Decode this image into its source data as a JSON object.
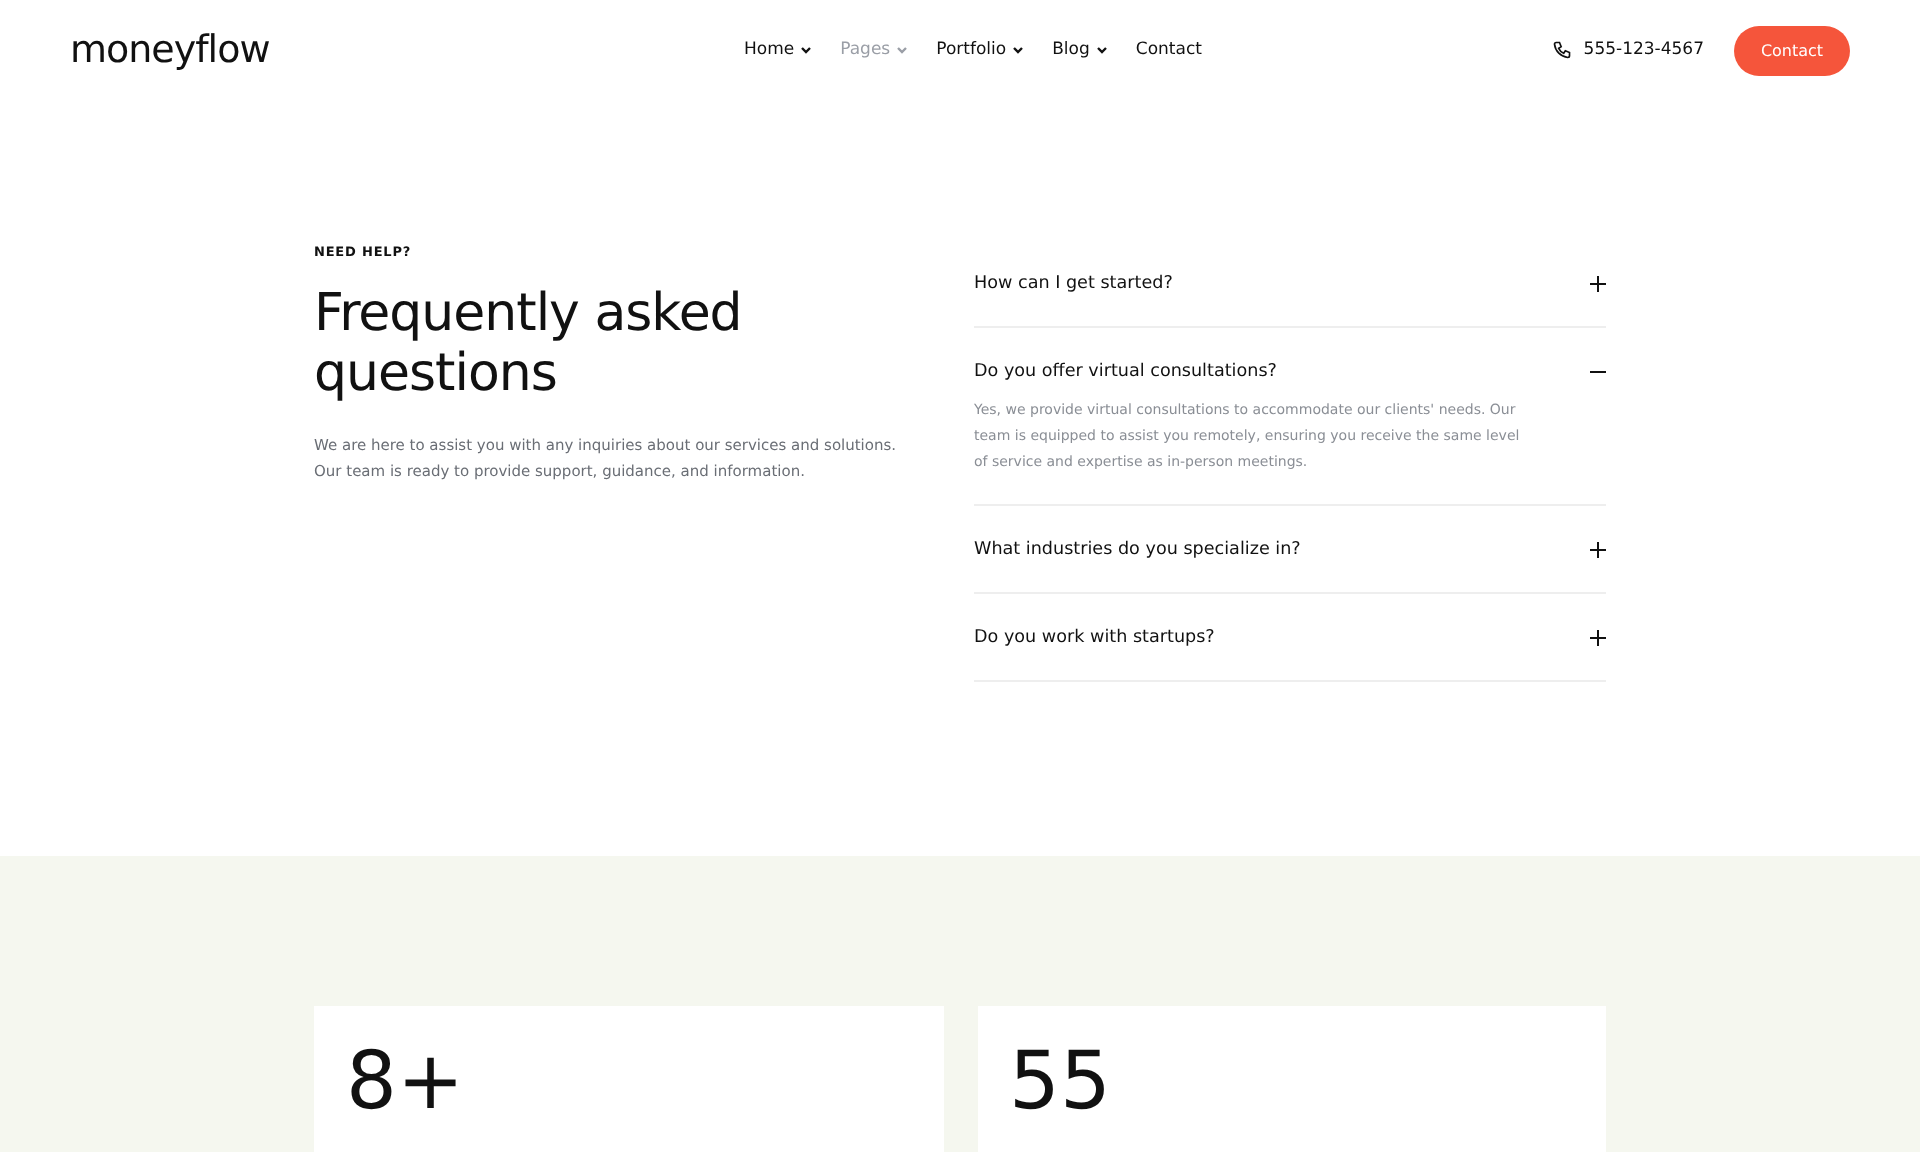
{
  "header": {
    "logo": "moneyflow",
    "nav": [
      {
        "label": "Home",
        "dropdown": true,
        "selected": false
      },
      {
        "label": "Pages",
        "dropdown": true,
        "selected": true
      },
      {
        "label": "Portfolio",
        "dropdown": true,
        "selected": false
      },
      {
        "label": "Blog",
        "dropdown": true,
        "selected": false
      },
      {
        "label": "Contact",
        "dropdown": false,
        "selected": false
      }
    ],
    "phone": "555-123-4567",
    "cta": "Contact"
  },
  "faq": {
    "eyebrow": "NEED HELP?",
    "title": "Frequently asked questions",
    "intro": "We are here to assist you with any inquiries about our services and solutions. Our team is ready to provide support, guidance, and information.",
    "items": [
      {
        "question": "How can I get started?",
        "expanded": false
      },
      {
        "question": "Do you offer virtual consultations?",
        "expanded": true,
        "answer": "Yes, we provide virtual consultations to accommodate our clients' needs. Our team is equipped to assist you remotely, ensuring you receive the same level of service and expertise as in-person meetings."
      },
      {
        "question": "What industries do you specialize in?",
        "expanded": false
      },
      {
        "question": "Do you work with startups?",
        "expanded": false
      }
    ]
  },
  "stats": [
    {
      "value": "8+"
    },
    {
      "value": "55"
    }
  ]
}
